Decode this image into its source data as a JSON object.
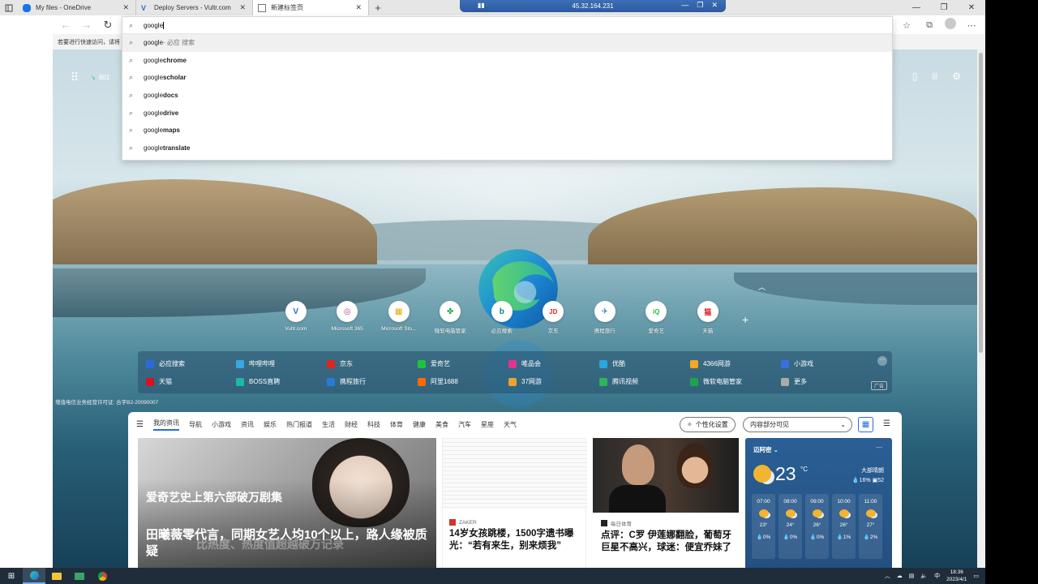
{
  "tabs": [
    {
      "title": "My files - OneDrive",
      "active": false
    },
    {
      "title": "Deploy Servers - Vultr.com",
      "active": false
    },
    {
      "title": "新建标签页",
      "active": true
    }
  ],
  "rdp": {
    "ip": "45.32.164.231"
  },
  "infobar": {
    "text": "若要进行快速访问，请将"
  },
  "omnibox": {
    "query": "google",
    "suggestions": [
      {
        "prefix": "google",
        "bold": "",
        "hint": " - 必应 搜索",
        "highlighted": true
      },
      {
        "prefix": "google ",
        "bold": "chrome",
        "hint": ""
      },
      {
        "prefix": "google ",
        "bold": "scholar",
        "hint": ""
      },
      {
        "prefix": "google ",
        "bold": "docs",
        "hint": ""
      },
      {
        "prefix": "google ",
        "bold": "drive",
        "hint": ""
      },
      {
        "prefix": "google ",
        "bold": "maps",
        "hint": ""
      },
      {
        "prefix": "google ",
        "bold": "translate",
        "hint": ""
      }
    ]
  },
  "ntp": {
    "weather_mini": "601",
    "quick_links": [
      {
        "label": "Vultr.com",
        "glyph": "V",
        "color": "#2b6ad9"
      },
      {
        "label": "Microsoft 365",
        "glyph": "◎",
        "color": "#c2378d"
      },
      {
        "label": "Microsoft Sto...",
        "glyph": "▦",
        "color": "#e6a700"
      },
      {
        "label": "微软电脑管家",
        "glyph": "✤",
        "color": "#1fa34a"
      },
      {
        "label": "必应搜索",
        "glyph": "b",
        "color": "#0d8b7c"
      },
      {
        "label": "京东",
        "glyph": "JD",
        "color": "#e1251b"
      },
      {
        "label": "携程旅行",
        "glyph": "✈",
        "color": "#2a7bd8"
      },
      {
        "label": "爱奇艺",
        "glyph": "iQ",
        "color": "#1ec33c"
      },
      {
        "label": "天猫",
        "glyph": "猫",
        "color": "#d6131e"
      }
    ],
    "links": [
      {
        "label": "必应搜索",
        "color": "#2b6ad9"
      },
      {
        "label": "哔哩哔哩",
        "color": "#3aa7e8"
      },
      {
        "label": "京东",
        "color": "#e1251b"
      },
      {
        "label": "爱奇艺",
        "color": "#1ec33c"
      },
      {
        "label": "唯品会",
        "color": "#e2338c"
      },
      {
        "label": "优酷",
        "color": "#2aa7e0"
      },
      {
        "label": "4366网游",
        "color": "#f5a623"
      },
      {
        "label": "小游戏",
        "color": "#3b6fe0"
      },
      {
        "label": "天猫",
        "color": "#d6131e"
      },
      {
        "label": "BOSS直聘",
        "color": "#1fb8a5"
      },
      {
        "label": "携程旅行",
        "color": "#2a7bd8"
      },
      {
        "label": "阿里1688",
        "color": "#ff6a00"
      },
      {
        "label": "37网游",
        "color": "#f0a030"
      },
      {
        "label": "腾讯视频",
        "color": "#2fb45a"
      },
      {
        "label": "微软电脑管家",
        "color": "#1fa34a"
      },
      {
        "label": "更多",
        "color": "#aaaaaa"
      }
    ],
    "ad_label": "广告",
    "icp": "增值电信业务经营许可证: 合字B2-20090007"
  },
  "feed": {
    "nav": [
      "我的资讯",
      "导航",
      "小游戏",
      "资讯",
      "娱乐",
      "热门报道",
      "生活",
      "财经",
      "科技",
      "体育",
      "健康",
      "美食",
      "汽车",
      "星座",
      "天气"
    ],
    "personalize": "个性化设置",
    "visibility": "内容部分可见",
    "hero": {
      "subtitle": "爱奇艺史上第六部破万剧集",
      "title": "田曦薇零代言，同期女艺人均10个以上，路人缘被质疑",
      "overlay": "比热度、热度值超越破万记录"
    },
    "doc": {
      "source": "ZAKER",
      "title": "14岁女孩跳楼，1500字遗书曝光：“若有来生，别来烦我”"
    },
    "sport": {
      "source": "每日体育",
      "title": "点评：C罗 伊莲娜翻脸，葡萄牙巨星不高兴，球迷：便宜乔妹了"
    },
    "weather": {
      "city": "迈阿密",
      "temp": "23",
      "unit": "°C",
      "condition": "大部晴朗",
      "humidity": "16%",
      "aqi": "52",
      "hours": [
        {
          "time": "07:00",
          "temp": "23°",
          "precip": "0%"
        },
        {
          "time": "08:00",
          "temp": "24°",
          "precip": "0%"
        },
        {
          "time": "09:00",
          "temp": "26°",
          "precip": "0%"
        },
        {
          "time": "10:00",
          "temp": "26°",
          "precip": "1%"
        },
        {
          "time": "11:00",
          "temp": "27°",
          "precip": "2%"
        }
      ]
    }
  },
  "taskbar": {
    "time": "18:36",
    "date": "2023/4/1",
    "ime": "中"
  }
}
